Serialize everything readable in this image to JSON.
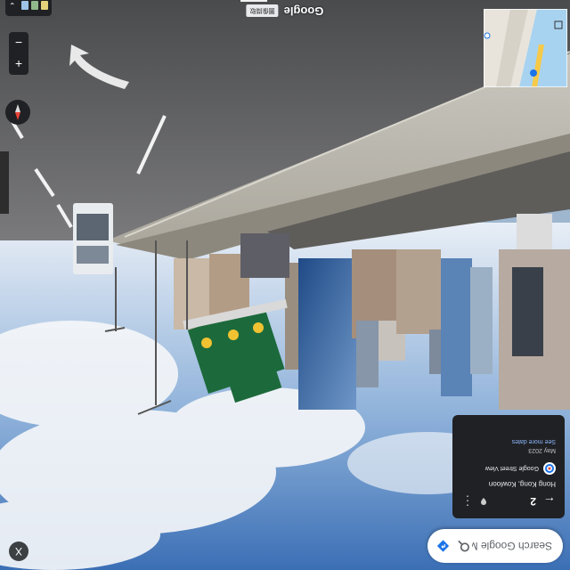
{
  "search": {
    "placeholder": "Search Google Maps"
  },
  "info_card": {
    "number": "2",
    "title": "Hong Kong, Kowloon",
    "service": "Google Street View",
    "date": "May 2023",
    "see_more": "See more dates"
  },
  "controls": {
    "close": "X",
    "zoom_in": "+",
    "zoom_out": "−"
  },
  "attribution": {
    "brand": "Google",
    "copyright": "圖像擷取"
  },
  "colors": {
    "card_bg": "#202124",
    "accent": "#1a73e8",
    "sign_green": "#137333"
  }
}
